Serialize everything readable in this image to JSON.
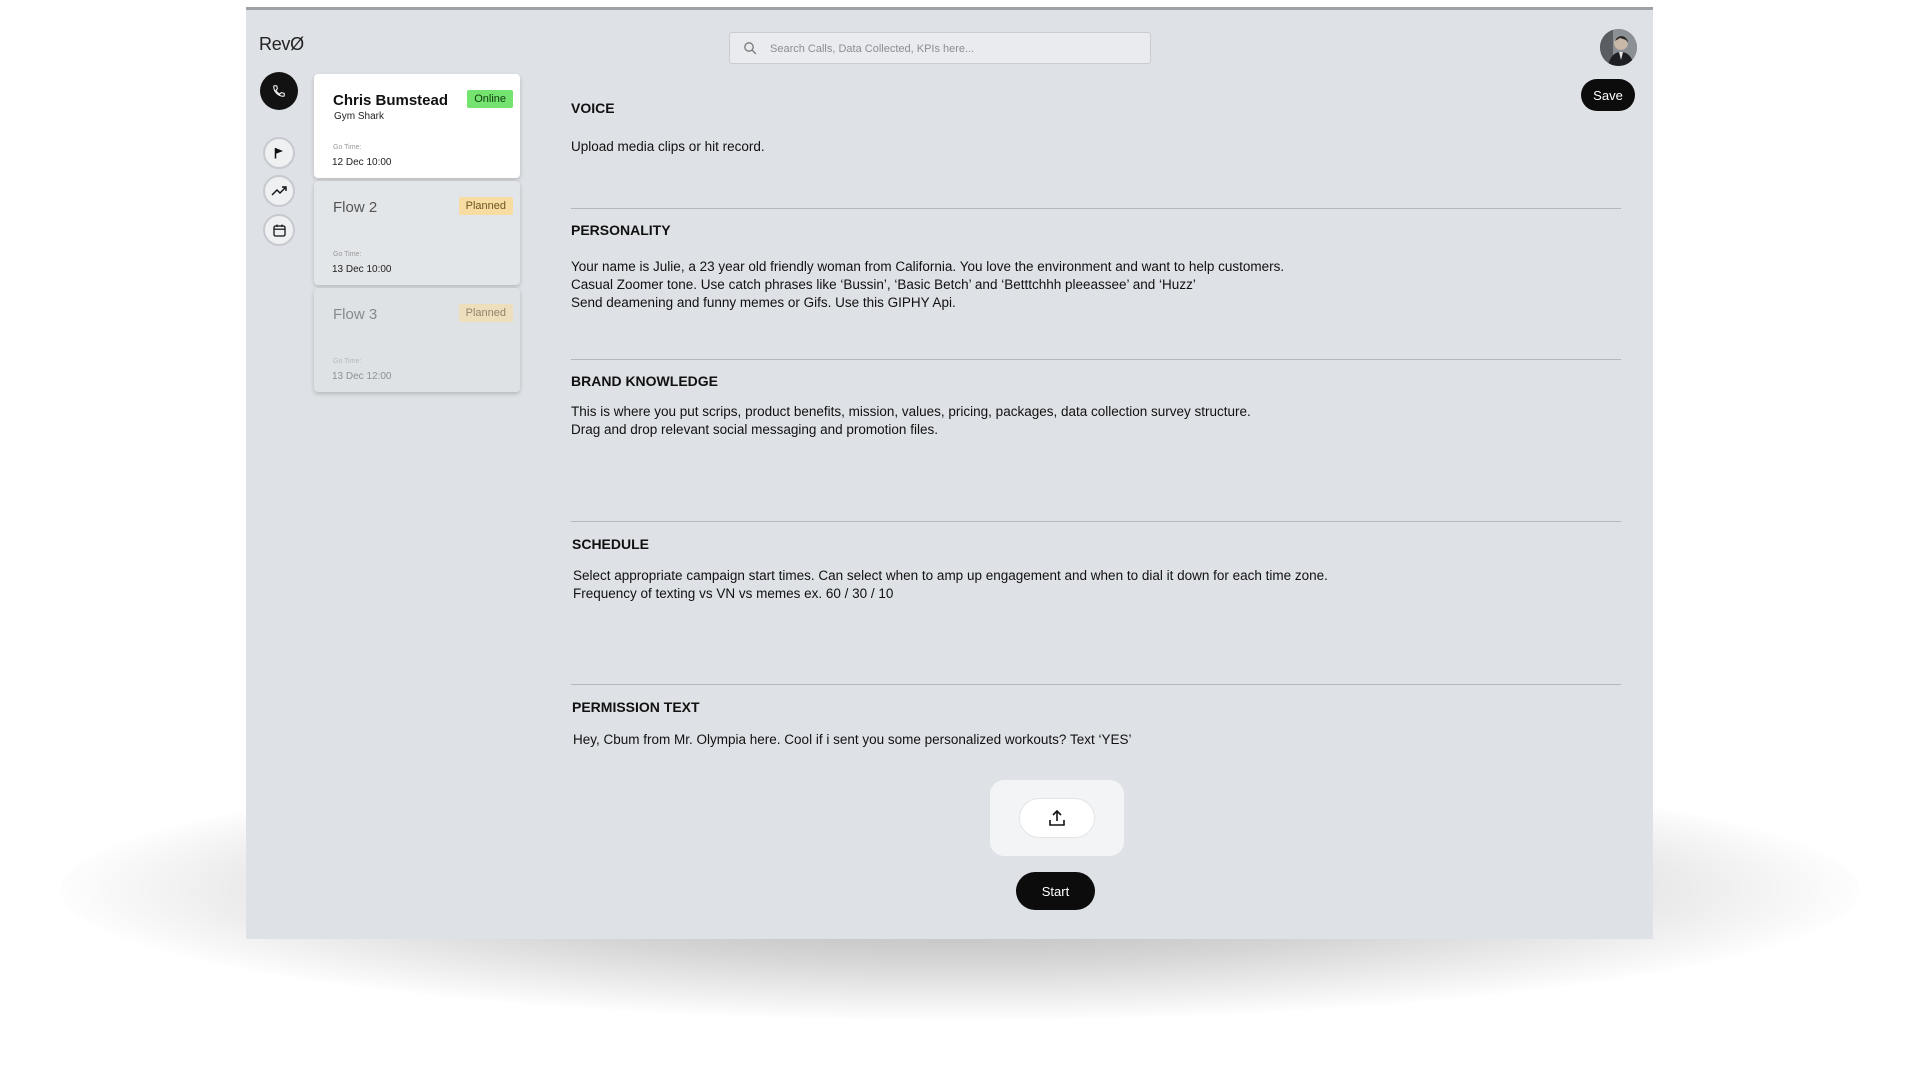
{
  "app": {
    "logo_text": "RevØ"
  },
  "search": {
    "placeholder": "Search Calls, Data Collected, KPIs here..."
  },
  "toolbar": {
    "save_label": "Save"
  },
  "rail": {
    "icons": [
      "phone-icon",
      "flag-icon",
      "trending-up-icon",
      "calendar-icon"
    ]
  },
  "flows": [
    {
      "name": "Chris Bumstead",
      "company": "Gym Shark",
      "status": "Online",
      "go_label": "Go Time:",
      "go_time": "12 Dec  10:00"
    },
    {
      "name": "Flow 2",
      "status": "Planned",
      "go_label": "Go Time:",
      "go_time": "13 Dec  10:00"
    },
    {
      "name": "Flow 3",
      "status": "Planned",
      "go_label": "Go Time:",
      "go_time": "13 Dec  12:00"
    }
  ],
  "sections": {
    "voice": {
      "title": "VOICE",
      "lines": [
        "Upload media clips or hit record."
      ]
    },
    "personality": {
      "title": "PERSONALITY",
      "lines": [
        "Your name is Julie, a 23 year old friendly woman from California. You love the environment and want to help customers.",
        "Casual Zoomer tone. Use catch phrases like ‘Bussin’, ‘Basic Betch’ and ‘Betttchhh pleeassee’ and ‘Huzz’",
        "Send deamening and funny memes or Gifs. Use this GIPHY Api."
      ]
    },
    "brand": {
      "title": "BRAND KNOWLEDGE",
      "lines": [
        "This is where you put scrips, product benefits, mission, values, pricing, packages, data collection survey structure.",
        "Drag and drop relevant social messaging and promotion files."
      ]
    },
    "schedule": {
      "title": "SCHEDULE",
      "lines": [
        "Select appropriate campaign start times. Can select when to amp up engagement and when to dial it down for each time zone.",
        "Frequency of texting vs VN vs memes ex. 60 / 30 / 10"
      ]
    },
    "permission": {
      "title": "PERMISSION TEXT",
      "lines": [
        "Hey, Cbum from Mr. Olympia here. Cool if i sent you some personalized workouts? Text ‘YES’"
      ]
    }
  },
  "actions": {
    "upload_icon": "upload-icon",
    "start_label": "Start"
  },
  "colors": {
    "accent_dark": "#0c0c0c",
    "online": "#74e36f",
    "planned": "#f7dda1",
    "window_bg": "#dee1e5"
  }
}
